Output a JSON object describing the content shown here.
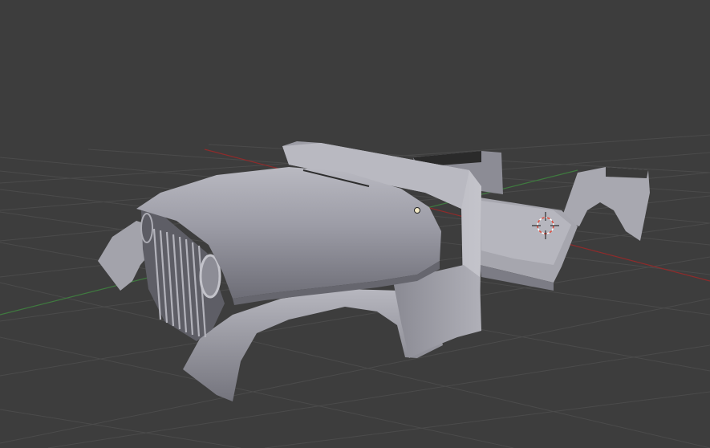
{
  "viewport": {
    "background": "#3d3d3d",
    "grid_color": "#4a4a4a",
    "x_axis_color": "#8e2b2b",
    "y_axis_color": "#3f7a3f",
    "mesh_color": "#a2a2ab"
  },
  "scene": {
    "object": "jeep-body-mesh",
    "origin": "object-origin-dot",
    "cursor": "3d-cursor-icon"
  }
}
